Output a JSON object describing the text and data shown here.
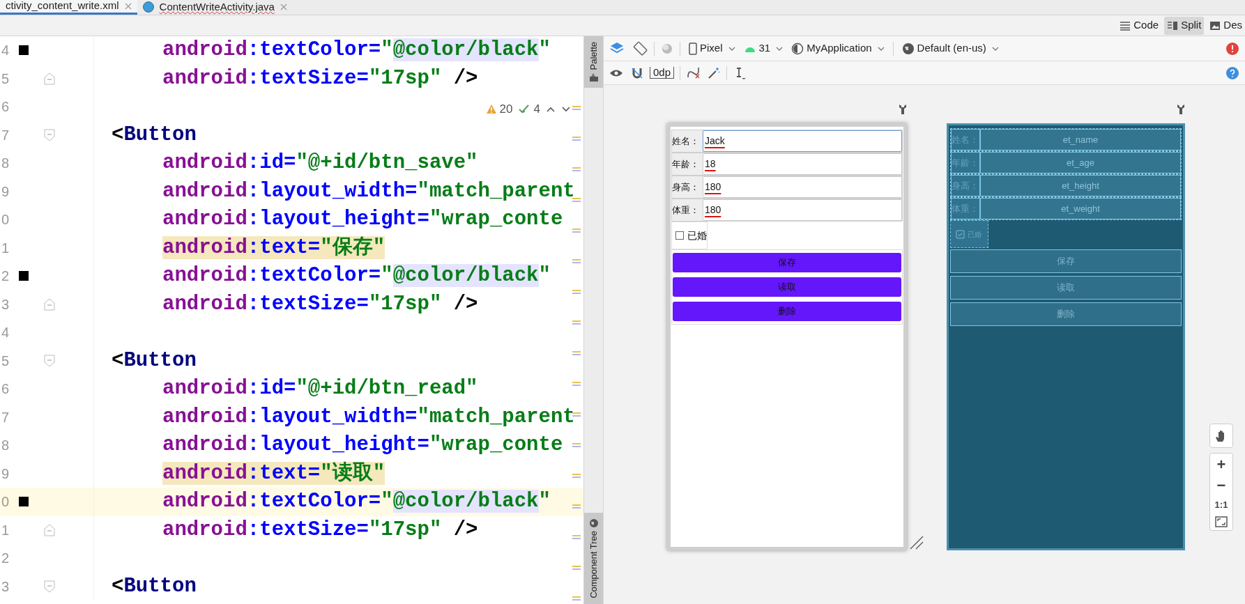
{
  "tabs": [
    {
      "label": "ctivity_content_write.xml",
      "selected": true,
      "kind": "xml"
    },
    {
      "label": "ContentWriteActivity.java",
      "selected": false,
      "kind": "java"
    }
  ],
  "view_modes": [
    {
      "label": "Code",
      "selected": false,
      "kind": "code"
    },
    {
      "label": "Split",
      "selected": true,
      "kind": "split"
    },
    {
      "label": "Des",
      "selected": false,
      "kind": "design"
    }
  ],
  "editor": {
    "inspections": {
      "warnings": "20",
      "weak_warnings": "4"
    },
    "lines": [
      {
        "number": "4",
        "marker": true,
        "highlight": false,
        "current": false,
        "tokens": [
          {
            "kind": "ns",
            "text": "android"
          },
          {
            "kind": "attr",
            "text": ":textColor"
          },
          {
            "kind": "eq",
            "text": "="
          },
          {
            "kind": "str",
            "text": "\""
          },
          {
            "kind": "ref",
            "text": "@color/black"
          },
          {
            "kind": "str",
            "text": "\""
          }
        ]
      },
      {
        "number": "5",
        "marker": false,
        "highlight": false,
        "current": false,
        "fold": {
          "kind": "end"
        },
        "tokens": [
          {
            "kind": "ns",
            "text": "android"
          },
          {
            "kind": "attr",
            "text": ":textSize"
          },
          {
            "kind": "eq",
            "text": "="
          },
          {
            "kind": "str",
            "text": "\"17sp\""
          },
          {
            "kind": "punct",
            "text": " />"
          }
        ]
      },
      {
        "number": "6",
        "marker": false,
        "current": false
      },
      {
        "number": "7",
        "marker": false,
        "highlight": false,
        "current": false,
        "fold": {
          "kind": "start"
        },
        "tokens": [
          {
            "kind": "punct",
            "text": "<"
          },
          {
            "kind": "tag",
            "text": "Button"
          }
        ]
      },
      {
        "number": "8",
        "marker": false,
        "highlight": false,
        "current": false,
        "tokens": [
          {
            "kind": "ns",
            "text": "android"
          },
          {
            "kind": "attr",
            "text": ":id"
          },
          {
            "kind": "eq",
            "text": "="
          },
          {
            "kind": "str",
            "text": "\"@+id/btn_save\""
          }
        ]
      },
      {
        "number": "9",
        "marker": false,
        "highlight": false,
        "current": false,
        "tokens": [
          {
            "kind": "ns",
            "text": "android"
          },
          {
            "kind": "attr",
            "text": ":layout_width"
          },
          {
            "kind": "eq",
            "text": "="
          },
          {
            "kind": "str",
            "text": "\"match_parent"
          }
        ]
      },
      {
        "number": "0",
        "marker": false,
        "highlight": false,
        "current": false,
        "tokens": [
          {
            "kind": "ns",
            "text": "android"
          },
          {
            "kind": "attr",
            "text": ":layout_height"
          },
          {
            "kind": "eq",
            "text": "="
          },
          {
            "kind": "str",
            "text": "\"wrap_conte"
          }
        ]
      },
      {
        "number": "1",
        "marker": false,
        "highlight": true,
        "current": false,
        "tokens": [
          {
            "kind": "ns",
            "text": "android"
          },
          {
            "kind": "attr",
            "text": ":text"
          },
          {
            "kind": "eq",
            "text": "="
          },
          {
            "kind": "str",
            "text": "\"保存\""
          }
        ]
      },
      {
        "number": "2",
        "marker": true,
        "highlight": false,
        "current": false,
        "tokens": [
          {
            "kind": "ns",
            "text": "android"
          },
          {
            "kind": "attr",
            "text": ":textColor"
          },
          {
            "kind": "eq",
            "text": "="
          },
          {
            "kind": "str",
            "text": "\""
          },
          {
            "kind": "ref",
            "text": "@color/black"
          },
          {
            "kind": "str",
            "text": "\""
          }
        ]
      },
      {
        "number": "3",
        "marker": false,
        "highlight": false,
        "current": false,
        "fold": {
          "kind": "end"
        },
        "tokens": [
          {
            "kind": "ns",
            "text": "android"
          },
          {
            "kind": "attr",
            "text": ":textSize"
          },
          {
            "kind": "eq",
            "text": "="
          },
          {
            "kind": "str",
            "text": "\"17sp\""
          },
          {
            "kind": "punct",
            "text": " />"
          }
        ]
      },
      {
        "number": "4",
        "marker": false,
        "current": false
      },
      {
        "number": "5",
        "marker": false,
        "highlight": false,
        "current": false,
        "fold": {
          "kind": "start"
        },
        "tokens": [
          {
            "kind": "punct",
            "text": "<"
          },
          {
            "kind": "tag",
            "text": "Button"
          }
        ]
      },
      {
        "number": "6",
        "marker": false,
        "highlight": false,
        "current": false,
        "tokens": [
          {
            "kind": "ns",
            "text": "android"
          },
          {
            "kind": "attr",
            "text": ":id"
          },
          {
            "kind": "eq",
            "text": "="
          },
          {
            "kind": "str",
            "text": "\"@+id/btn_read\""
          }
        ]
      },
      {
        "number": "7",
        "marker": false,
        "highlight": false,
        "current": false,
        "tokens": [
          {
            "kind": "ns",
            "text": "android"
          },
          {
            "kind": "attr",
            "text": ":layout_width"
          },
          {
            "kind": "eq",
            "text": "="
          },
          {
            "kind": "str",
            "text": "\"match_parent"
          }
        ]
      },
      {
        "number": "8",
        "marker": false,
        "highlight": false,
        "current": false,
        "tokens": [
          {
            "kind": "ns",
            "text": "android"
          },
          {
            "kind": "attr",
            "text": ":layout_height"
          },
          {
            "kind": "eq",
            "text": "="
          },
          {
            "kind": "str",
            "text": "\"wrap_conte"
          }
        ]
      },
      {
        "number": "9",
        "marker": false,
        "highlight": true,
        "current": false,
        "tokens": [
          {
            "kind": "ns",
            "text": "android"
          },
          {
            "kind": "attr",
            "text": ":text"
          },
          {
            "kind": "eq",
            "text": "="
          },
          {
            "kind": "str",
            "text": "\"读取\""
          }
        ]
      },
      {
        "number": "0",
        "marker": true,
        "highlight": false,
        "current": true,
        "tokens": [
          {
            "kind": "ns",
            "text": "android"
          },
          {
            "kind": "attr",
            "text": ":textColor"
          },
          {
            "kind": "eq",
            "text": "="
          },
          {
            "kind": "str",
            "text": "\""
          },
          {
            "kind": "ref",
            "text": "@color/black"
          },
          {
            "kind": "str",
            "text": "\""
          }
        ]
      },
      {
        "number": "1",
        "marker": false,
        "highlight": false,
        "current": false,
        "fold": {
          "kind": "end"
        },
        "tokens": [
          {
            "kind": "ns",
            "text": "android"
          },
          {
            "kind": "attr",
            "text": ":textSize"
          },
          {
            "kind": "eq",
            "text": "="
          },
          {
            "kind": "str",
            "text": "\"17sp\""
          },
          {
            "kind": "punct",
            "text": " />"
          }
        ]
      },
      {
        "number": "2",
        "marker": false,
        "current": false
      },
      {
        "number": "3",
        "marker": false,
        "highlight": false,
        "current": false,
        "fold": {
          "kind": "start"
        },
        "tokens": [
          {
            "kind": "punct",
            "text": "<"
          },
          {
            "kind": "tag",
            "text": "Button"
          }
        ]
      }
    ]
  },
  "side_tabs": [
    {
      "label": "Palette",
      "kind": "palette"
    },
    {
      "label": "Component Tree",
      "kind": "tree"
    }
  ],
  "design_toolbar": {
    "device": "Pixel",
    "api": "31",
    "theme": "MyApplication",
    "locale": "Default (en-us)",
    "margin": "0dp"
  },
  "preview": {
    "fields": [
      {
        "label": "姓名：",
        "value": "Jack",
        "focused": true
      },
      {
        "label": "年龄：",
        "value": "18",
        "focused": false
      },
      {
        "label": "身高：",
        "value": "180",
        "focused": false
      },
      {
        "label": "体重：",
        "value": "180",
        "focused": false
      }
    ],
    "checkbox": {
      "label": "已婚",
      "checked": false
    },
    "buttons": [
      "保存",
      "读取",
      "删除"
    ]
  },
  "blueprint": {
    "fields": [
      {
        "label": "姓名：",
        "id": "et_name"
      },
      {
        "label": "年龄：",
        "id": "et_age"
      },
      {
        "label": "身高：",
        "id": "et_height"
      },
      {
        "label": "体重：",
        "id": "et_weight"
      }
    ],
    "checkbox": {
      "label": "已婚",
      "checked": true
    },
    "buttons": [
      "保存",
      "读取",
      "删除"
    ]
  },
  "zoom_controls": [
    {
      "label": "+",
      "kind": "in"
    },
    {
      "label": "−",
      "kind": "out"
    },
    {
      "label": "1:1",
      "kind": "actual"
    }
  ]
}
